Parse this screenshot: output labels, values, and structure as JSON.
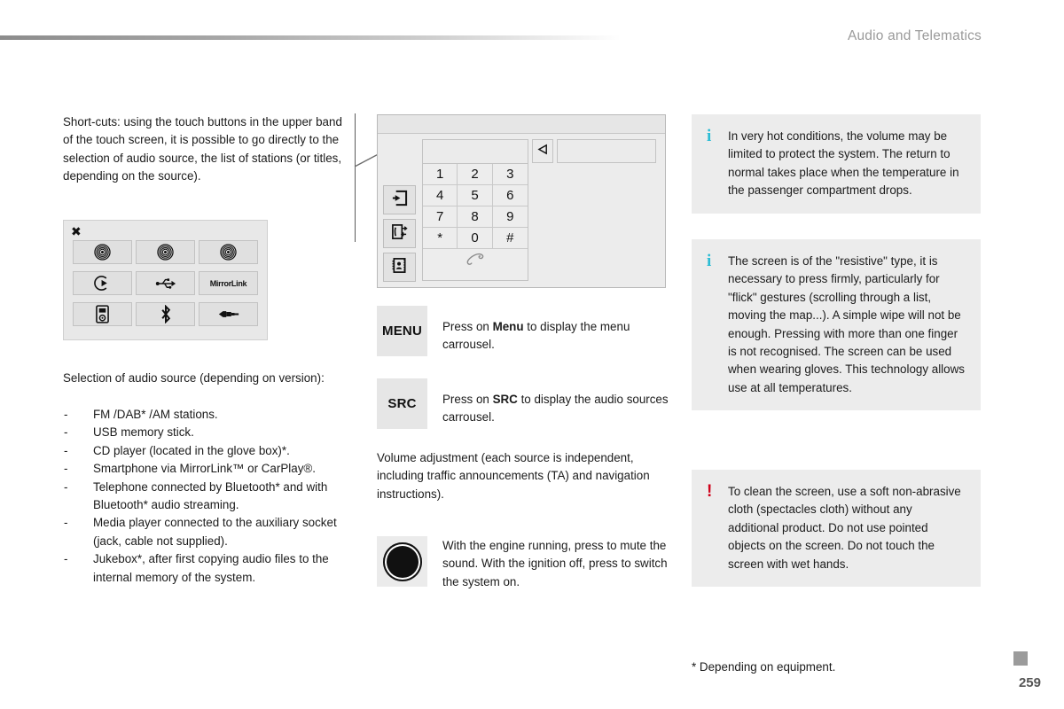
{
  "header": {
    "section_title": "Audio and Telematics"
  },
  "left": {
    "intro": "Short-cuts: using the touch buttons in the upper band of the touch screen, it is possible to go directly to the selection of audio source, the list of stations (or titles, depending on the source).",
    "source_panel": {
      "close_label": "✖",
      "items": [
        {
          "name": "radio-fm-icon",
          "label": ""
        },
        {
          "name": "radio-dab-icon",
          "label": ""
        },
        {
          "name": "radio-am-icon",
          "label": ""
        },
        {
          "name": "cd-player-icon",
          "label": ""
        },
        {
          "name": "usb-icon",
          "label": ""
        },
        {
          "name": "mirrorlink-icon",
          "label": "MirrorLink"
        },
        {
          "name": "media-player-icon",
          "label": ""
        },
        {
          "name": "bluetooth-icon",
          "label": ""
        },
        {
          "name": "aux-jack-icon",
          "label": ""
        }
      ]
    },
    "list_intro": "Selection of audio source (depending on version):",
    "list_items": [
      "FM /DAB* /AM stations.",
      "USB memory stick.",
      "CD player (located in the glove box)*.",
      "Smartphone via MirrorLink™ or CarPlay®.",
      "Telephone connected by Bluetooth* and with Bluetooth* audio streaming.",
      "Media player connected to the auxiliary socket (jack, cable not supplied).",
      "Jukebox*, after first copying audio files to the internal memory of the system."
    ]
  },
  "middle": {
    "screen": {
      "keys": [
        "1",
        "2",
        "3",
        "4",
        "5",
        "6",
        "7",
        "8",
        "9",
        "*",
        "0",
        "#"
      ],
      "call_icon": "handset-icon",
      "backspace_icon": "backspace-arrow-icon",
      "side_buttons": [
        {
          "name": "dial-entry-icon"
        },
        {
          "name": "call-log-icon"
        },
        {
          "name": "phonebook-icon"
        }
      ]
    },
    "menu_key": {
      "cap": "MENU",
      "text_before": "Press on ",
      "text_bold": "Menu",
      "text_after": " to display the menu carrousel."
    },
    "src_key": {
      "cap": "SRC",
      "text_before": "Press on ",
      "text_bold": "SRC",
      "text_after": " to display the audio sources carrousel."
    },
    "volume_text": "Volume adjustment (each source is independent, including traffic announcements (TA) and navigation instructions).",
    "knob": {
      "icon": "volume-knob-icon",
      "text": "With the engine running, press to mute the sound. With the ignition off, press to switch the system on.",
      "line1": "With the engine running, press to",
      "line2": "mute the sound.",
      "line3": "With the ignition off, press to switch",
      "line4": "the system on."
    }
  },
  "right": {
    "notes": [
      {
        "type": "info",
        "glyph": "i",
        "icon_name": "info-icon",
        "color": "#2bbcd4",
        "text": "In very hot conditions, the volume may be limited to protect the system. The return to normal takes place when the temperature in the passenger compartment drops."
      },
      {
        "type": "info",
        "glyph": "i",
        "icon_name": "info-icon",
        "color": "#2bbcd4",
        "text": "The screen is of the \"resistive\" type, it is necessary to press firmly, particularly for \"flick\" gestures (scrolling through a list, moving the map...). A simple wipe will not be enough. Pressing with more than one finger is not recognised. The screen can be used when wearing gloves. This technology allows use at all temperatures."
      },
      {
        "type": "warning",
        "glyph": "!",
        "icon_name": "warning-icon",
        "color": "#d0021b",
        "text": "To clean the screen, use a soft non-abrasive cloth (spectacles cloth) without any additional product. Do not use pointed objects on the screen. Do not touch the screen with wet hands."
      }
    ]
  },
  "footer": {
    "footnote": "* Depending on equipment.",
    "page_number": "259"
  }
}
